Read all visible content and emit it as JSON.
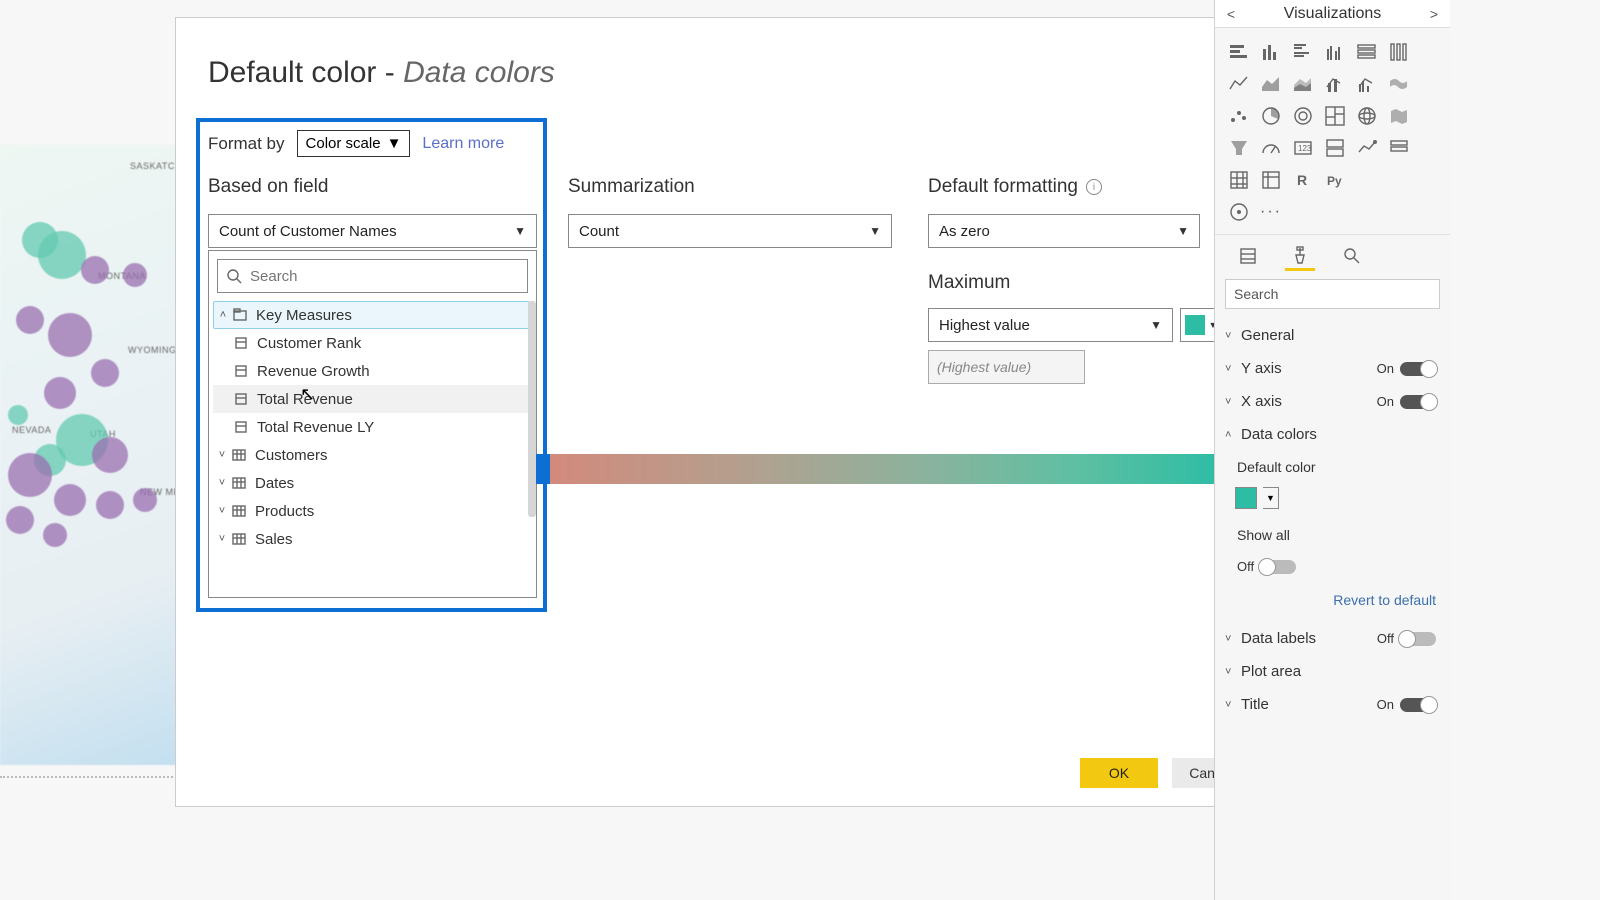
{
  "dialog": {
    "title_main": "Default color - ",
    "title_sub": "Data colors",
    "format_by_label": "Format by",
    "format_by_value": "Color scale",
    "learn_more": "Learn more",
    "based_on_field_label": "Based on field",
    "based_on_field_value": "Count of Customer Names",
    "summarization_label": "Summarization",
    "summarization_value": "Count",
    "default_fmt_label": "Default formatting",
    "default_fmt_value": "As zero",
    "maximum_label": "Maximum",
    "maximum_value": "Highest value",
    "maximum_readonly": "(Highest value)",
    "max_color": "#2dbda4",
    "search_placeholder": "Search",
    "ok": "OK",
    "cancel": "Cancel"
  },
  "field_tree": {
    "group_key_measures": "Key Measures",
    "m_customer_rank": "Customer Rank",
    "m_revenue_growth": "Revenue Growth",
    "m_total_revenue": "Total Revenue",
    "m_total_revenue_ly": "Total Revenue LY",
    "t_customers": "Customers",
    "t_dates": "Dates",
    "t_products": "Products",
    "t_sales": "Sales"
  },
  "viz_pane": {
    "title": "Visualizations",
    "search": "Search",
    "fmt_general": "General",
    "fmt_y_axis": "Y axis",
    "fmt_x_axis": "X axis",
    "fmt_data_colors": "Data colors",
    "fmt_default_color": "Default color",
    "fmt_show_all": "Show all",
    "fmt_revert": "Revert to default",
    "fmt_data_labels": "Data labels",
    "fmt_plot_area": "Plot area",
    "fmt_title": "Title",
    "on": "On",
    "off": "Off",
    "default_color_value": "#2dbda4"
  },
  "map_labels": {
    "sask": "SASKATCH",
    "montana": "MONTANA",
    "wyoming": "WYOMING",
    "nevada": "NEVADA",
    "utah": "UTAH",
    "newmex": "NEW MEX"
  }
}
